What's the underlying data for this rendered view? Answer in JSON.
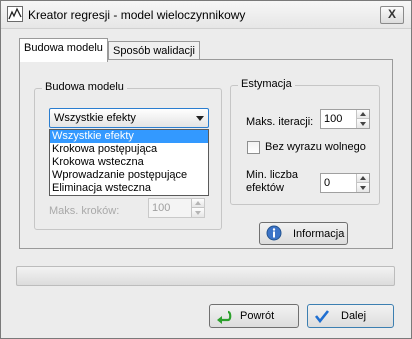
{
  "window": {
    "title": "Kreator regresji - model wieloczynnikowy",
    "close_glyph": "X"
  },
  "tabs": [
    {
      "label": "Budowa modelu",
      "active": true
    },
    {
      "label": "Sposób walidacji",
      "active": false
    }
  ],
  "budowa_modelu": {
    "group_title": "Budowa modelu",
    "selected": "Wszystkie efekty",
    "options": [
      "Wszystkie efekty",
      "Krokowa postępująca",
      "Krokowa wsteczna",
      "Wprowadzanie postępujące",
      "Eliminacja wsteczna"
    ],
    "max_steps_label": "Maks. kroków:",
    "max_steps_value": "100"
  },
  "estymacja": {
    "group_title": "Estymacja",
    "max_iter_label": "Maks. iteracji:",
    "max_iter_value": "100",
    "no_intercept_label": "Bez wyrazu wolnego",
    "no_intercept_checked": false,
    "min_effects_label_line1": "Min. liczba",
    "min_effects_label_line2": "efektów",
    "min_effects_value": "0"
  },
  "info_button": {
    "label": "Informacja",
    "icon": "info-icon"
  },
  "progress": {
    "fraction": 0
  },
  "footer": {
    "back_label": "Powrót",
    "back_icon": "back-arrow-icon",
    "next_label": "Dalej",
    "next_icon": "checkmark-icon"
  },
  "colors": {
    "selection": "#3399ff",
    "focus_border": "#2a7dcf",
    "back_icon": "#2ca02c",
    "next_icon": "#1f6fd1"
  }
}
